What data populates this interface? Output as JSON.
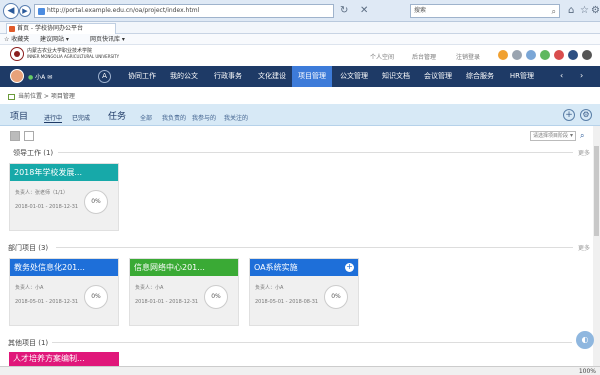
{
  "browser": {
    "url": "http://portal.example.edu.cn/oa/project/index.html",
    "search_placeholder": "搜索",
    "tab_title": "首页 - 学校协同办公平台",
    "favorites": [
      "☆ 收藏夹",
      "建议网站 ▾",
      "网页快讯库 ▾"
    ],
    "zoom": "100%"
  },
  "header": {
    "school_name_line1": "内蒙古农业大学职业技术学院",
    "school_name_line2": "INNER MONGOLIA AGRICULTURAL UNIVERSITY",
    "links": [
      "个人空间",
      "后台管理",
      "注销登录"
    ]
  },
  "nav": {
    "user": "小A",
    "a_label": "A",
    "items": [
      "协同工作",
      "我的公文",
      "行政事务",
      "文化建设",
      "项目管理",
      "公文管理",
      "知识文档",
      "会议管理",
      "综合服务",
      "HR管理"
    ],
    "active_index": 4
  },
  "breadcrumb": "当前位置 > 项目管理",
  "toolbar": {
    "project_label": "项目",
    "project_tabs": [
      "进行中",
      "已完成"
    ],
    "task_label": "任务",
    "task_tabs": [
      "全部",
      "我负责的",
      "我参与的",
      "我关注的"
    ],
    "add_icon": "+",
    "settings_icon": "⚙"
  },
  "filter": {
    "select_value": "请选择项目阶段"
  },
  "sections": [
    {
      "title": "领导工作 (1)",
      "more": "更多",
      "cards": [
        {
          "title": "2018年学校发展...",
          "color": "#17a9a9",
          "owner": "负责人：张老师（1/1）",
          "dates": "2018-01-01 - 2018-12-31",
          "progress": "0%"
        }
      ]
    },
    {
      "title": "部门项目 (3)",
      "more": "更多",
      "cards": [
        {
          "title": "教务处信息化201...",
          "color": "#1e6fd9",
          "owner": "负责人：小A",
          "dates": "2018-05-01 - 2018-12-31",
          "progress": "0%"
        },
        {
          "title": "信息网络中心201...",
          "color": "#3aaa35",
          "owner": "负责人：小A",
          "dates": "2018-01-01 - 2018-12-31",
          "progress": "0%"
        },
        {
          "title": "OA系统实施",
          "color": "#1e6fd9",
          "owner": "负责人：小A",
          "dates": "2018-05-01 - 2018-08-31",
          "progress": "0%",
          "badge": "+"
        }
      ]
    },
    {
      "title": "其他项目 (1)",
      "more": "",
      "cards": [
        {
          "title": "人才培养方案编制...",
          "color": "#e0177a",
          "owner": "",
          "dates": "",
          "progress": ""
        }
      ]
    }
  ]
}
